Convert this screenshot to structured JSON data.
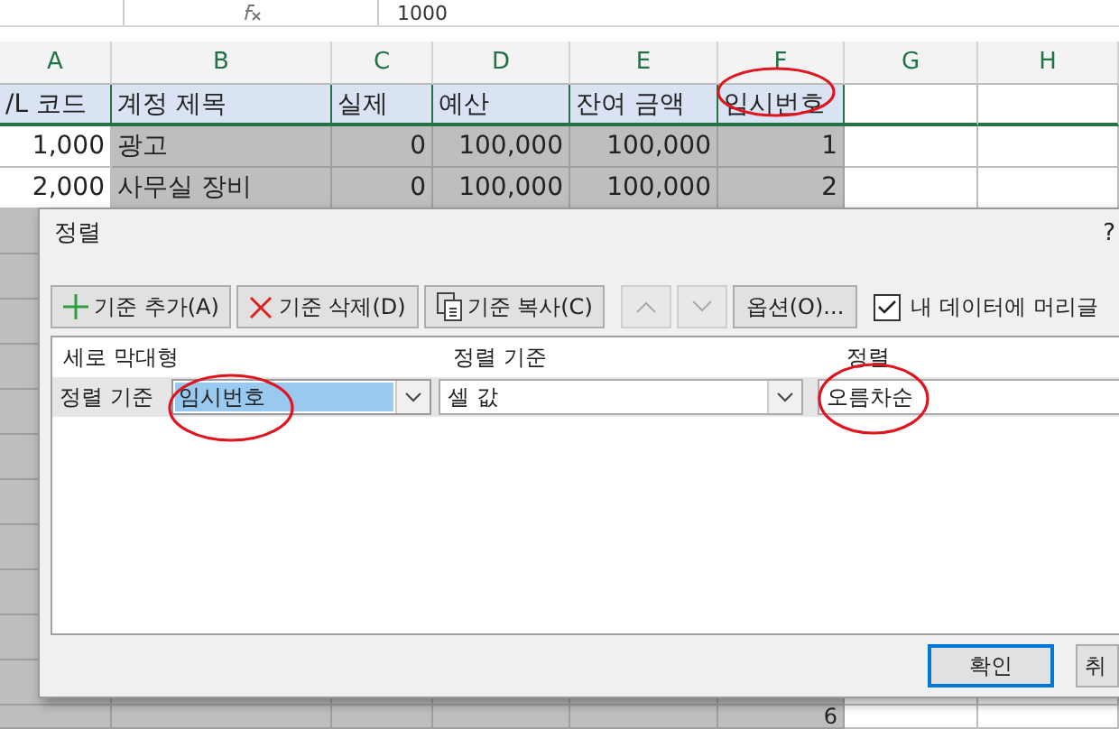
{
  "formula_bar": {
    "value": "1000"
  },
  "columns": [
    "A",
    "B",
    "C",
    "D",
    "E",
    "F",
    "G",
    "H"
  ],
  "header_row": [
    "/L 코드",
    "계정 제목",
    "실제",
    "예산",
    "잔여 금액",
    "임시번호"
  ],
  "rows": [
    [
      "1,000",
      "광고",
      "0",
      "100,000",
      "100,000",
      "1"
    ],
    [
      "2,000",
      "사무실 장비",
      "0",
      "100,000",
      "100,000",
      "2"
    ]
  ],
  "bottom_row": {
    "f_value": "6"
  },
  "dialog": {
    "title": "정렬",
    "help": "?",
    "toolbar": [
      {
        "kind": "add",
        "label": "기준 추가(A)"
      },
      {
        "kind": "delete",
        "label": "기준 삭제(D)"
      },
      {
        "kind": "copy",
        "label": "기준 복사(C)"
      },
      {
        "kind": "up",
        "disabled": true
      },
      {
        "kind": "down",
        "disabled": true
      },
      {
        "kind": "text",
        "label": "옵션(O)..."
      }
    ],
    "header_checkbox": {
      "label": "내 데이터에 머리글",
      "checked": true
    },
    "list_headers": [
      "세로 막대형",
      "정렬 기준",
      "정렬"
    ],
    "levels": [
      {
        "label": "정렬 기준",
        "column": "임시번호",
        "sort_on": "셀 값",
        "order": "오름차순",
        "selected": true
      }
    ],
    "buttons": [
      "확인",
      "취"
    ]
  }
}
